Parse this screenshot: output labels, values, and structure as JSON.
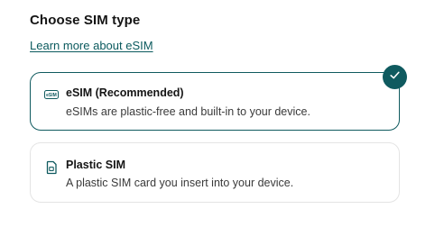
{
  "heading": "Choose SIM type",
  "learn_more_link": "Learn more about eSIM",
  "colors": {
    "accent": "#0f5a5f",
    "link": "#0b5a5e",
    "border_inactive": "#e4e4e4"
  },
  "options": [
    {
      "label": "eSIM (Recommended)",
      "description": "eSIMs are plastic-free and built-in to your device.",
      "icon": "esim-icon",
      "icon_text": "eSIM",
      "selected": true
    },
    {
      "label": "Plastic SIM",
      "description": "A plastic SIM card you insert into your device.",
      "icon": "sim-card-icon",
      "selected": false
    }
  ],
  "selected_indicator_icon": "checkmark-icon"
}
